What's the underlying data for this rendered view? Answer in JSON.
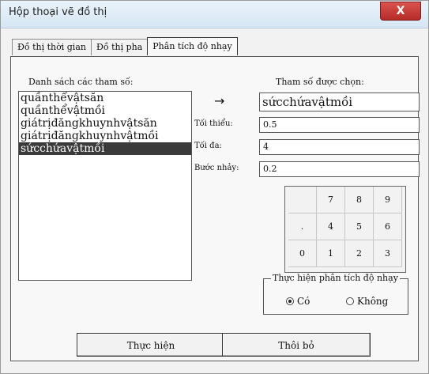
{
  "window": {
    "title": "Hộp thoại vẽ đồ thị",
    "close_label": "X"
  },
  "tabs": [
    {
      "label": "Đồ thị thời gian"
    },
    {
      "label": "Đồ thị pha"
    },
    {
      "label": "Phân tích độ nhạy",
      "active": true
    }
  ],
  "list": {
    "label": "Danh sách các tham số:",
    "items": [
      "quầnthểvậtsăn",
      "quầnthểvậtmồi",
      "giátrịđăngkhuynhvậtsăn",
      "giátrịđăngkhuynhvậtmồi",
      "sứcchứavậtmồi"
    ],
    "selected_index": 4
  },
  "chosen": {
    "label": "Tham số được chọn:",
    "value": "sứcchứavậtmồi",
    "arrow": "→"
  },
  "fields": {
    "min": {
      "label": "Tối thiểu:",
      "value": "0.5"
    },
    "max": {
      "label": "Tối đa:",
      "value": "4"
    },
    "step": {
      "label": "Bước nhảy:",
      "value": "0.2"
    }
  },
  "keypad": {
    "keys": [
      [
        "",
        "7",
        "8",
        "9"
      ],
      [
        ".",
        "4",
        "5",
        "6"
      ],
      [
        "0",
        "1",
        "2",
        "3"
      ]
    ]
  },
  "mode": {
    "legend": "Thực hiện phân tích độ nhạy",
    "yes_label": "Có",
    "no_label": "Không",
    "selected": "yes"
  },
  "buttons": {
    "run_label": "Thực hiện",
    "cancel_label": "Thôi bỏ"
  }
}
